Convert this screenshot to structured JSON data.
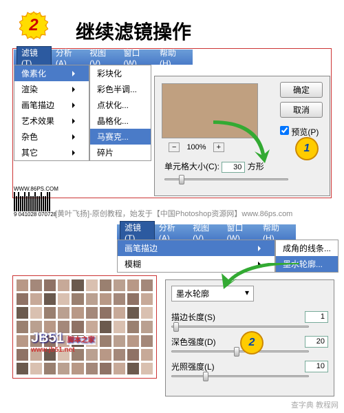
{
  "title": "继续滤镜操作",
  "menubar": [
    "滤镜(T)",
    "分析(A)",
    "视图(V)",
    "窗口(W)",
    "帮助(H)"
  ],
  "menu1": {
    "items": [
      "像素化",
      "渲染",
      "画笔描边",
      "艺术效果",
      "杂色",
      "其它"
    ],
    "highlight": "像素化"
  },
  "submenu1": {
    "items": [
      "彩块化",
      "彩色半调...",
      "点状化...",
      "晶格化...",
      "马赛克...",
      "碎片"
    ],
    "highlight": "马赛克..."
  },
  "dialog1": {
    "ok": "确定",
    "cancel": "取消",
    "preview": "预览(P)",
    "zoom": "100%",
    "cellLabel": "单元格大小(C):",
    "cellValue": "30",
    "unit": "方形"
  },
  "barcode": {
    "site": "WWW.86PS.COM",
    "num": "9 041028 070728"
  },
  "credit1": "[黄叶飞扬]-原创教程，始发于【中国Photoshop资源网】www.86ps.com",
  "menu2": {
    "items": [
      "画笔描边",
      "模糊"
    ],
    "highlight": "画笔描边"
  },
  "submenu2": {
    "items": [
      "成角的线条...",
      "墨水轮廓..."
    ],
    "highlight": "墨水轮廓..."
  },
  "dialog2": {
    "select": "墨水轮廓",
    "rows": [
      {
        "label": "描边长度(S)",
        "value": "1"
      },
      {
        "label": "深色强度(D)",
        "value": "20"
      },
      {
        "label": "光照强度(L)",
        "value": "10"
      }
    ]
  },
  "jb51": {
    "name": "JB51",
    "sub": "脚本之家",
    "url": "www.jb51.net"
  },
  "watermark": "查字典 教程网"
}
